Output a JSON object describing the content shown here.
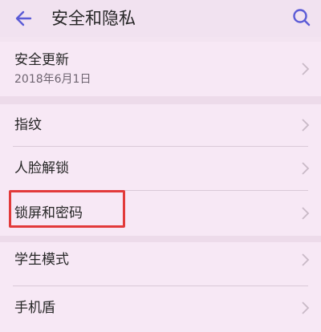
{
  "header": {
    "title": "安全和隐私",
    "back_icon": "arrow-left-icon",
    "search_icon": "search-icon",
    "accent_color": "#5b5bd6"
  },
  "items": [
    {
      "label": "安全更新",
      "sub": "2018年6月1日"
    },
    {
      "label": "指纹"
    },
    {
      "label": "人脸解锁"
    },
    {
      "label": "锁屏和密码",
      "highlighted": true
    },
    {
      "label": "学生模式"
    },
    {
      "label": "手机盾"
    }
  ],
  "highlight_color": "#e23a3a"
}
